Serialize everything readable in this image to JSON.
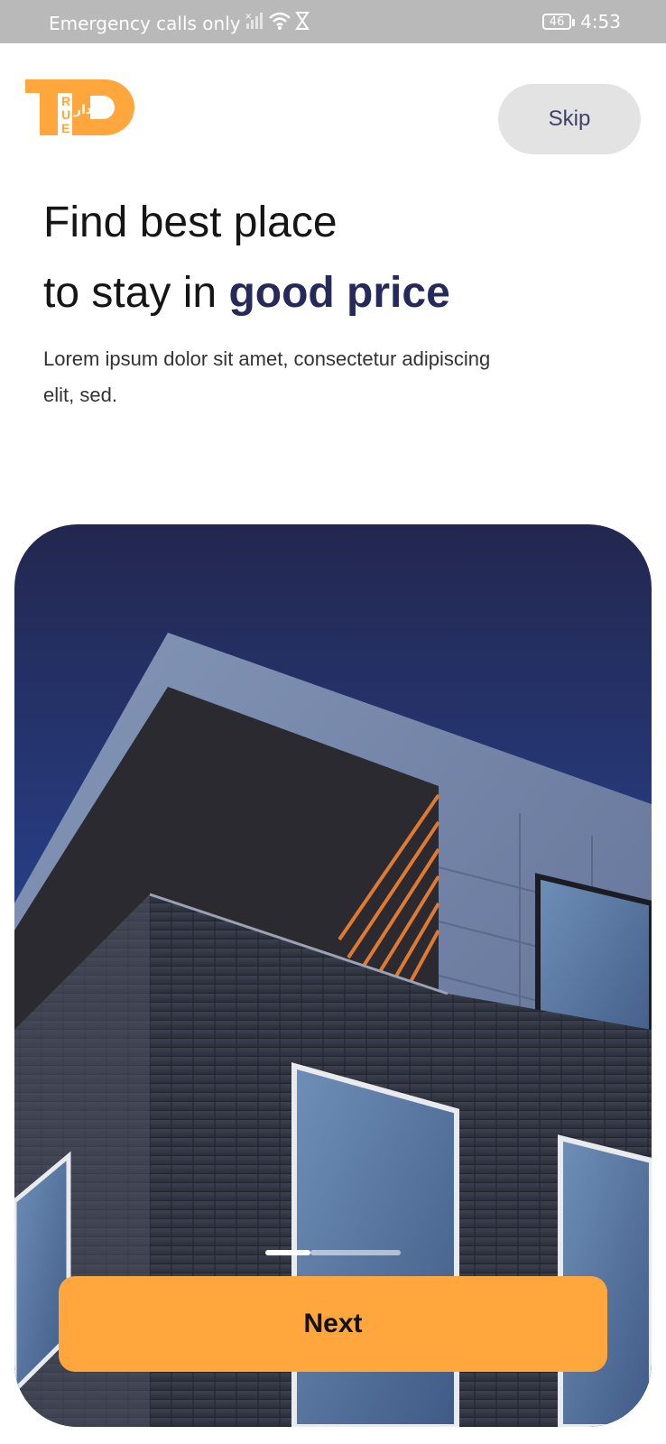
{
  "status_bar": {
    "carrier_text": "Emergency calls only",
    "battery_level": "46",
    "time": "4:53"
  },
  "header": {
    "logo_text": "TRUE دار",
    "skip_label": "Skip"
  },
  "onboarding": {
    "headline_line1": "Find best place",
    "headline_line2_prefix": "to stay in ",
    "headline_accent": "good price",
    "subtitle": "Lorem ipsum dolor sit amet, consectetur adipiscing elit, sed.",
    "page_indicator": {
      "current": 1,
      "total": 3
    },
    "next_label": "Next"
  },
  "colors": {
    "brand_orange": "#ffa63c",
    "accent_navy": "#262a5a",
    "skip_bg": "#e3e3e3"
  }
}
